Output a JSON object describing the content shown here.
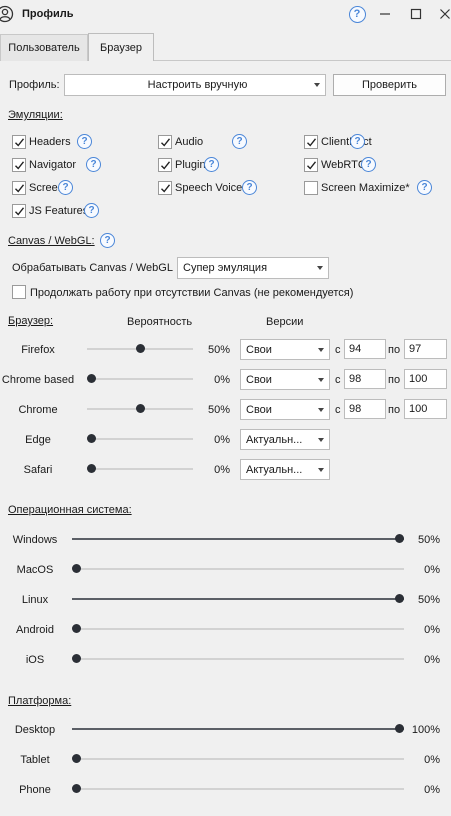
{
  "window": {
    "title": "Профиль"
  },
  "tabs": [
    {
      "label": "Пользователь",
      "active": false
    },
    {
      "label": "Браузер",
      "active": true
    }
  ],
  "profile": {
    "label": "Профиль:",
    "value": "Настроить вручную",
    "check_button": "Проверить"
  },
  "emulations": {
    "title": "Эмуляции:",
    "items": [
      {
        "label": "Headers",
        "checked": true
      },
      {
        "label": "Audio",
        "checked": true
      },
      {
        "label": "ClientRect",
        "checked": true
      },
      {
        "label": "Navigator",
        "checked": true
      },
      {
        "label": "Plugins",
        "checked": true
      },
      {
        "label": "WebRTC",
        "checked": true
      },
      {
        "label": "Screen",
        "checked": true
      },
      {
        "label": "Speech Voice",
        "checked": true
      },
      {
        "label": "Screen Maximize*",
        "checked": false
      },
      {
        "label": "JS Features",
        "checked": true
      }
    ]
  },
  "canvas": {
    "title": "Canvas / WebGL:",
    "process_label": "Обрабатывать Canvas / WebGL",
    "process_value": "Супер эмуляция",
    "continue_label": "Продолжать работу при отсутствии Canvas (не рекомендуется)",
    "continue_checked": false
  },
  "browser": {
    "title": "Браузер:",
    "col_probability": "Вероятность",
    "col_versions": "Версии",
    "from_label": "с",
    "to_label": "по",
    "rows": [
      {
        "name": "Firefox",
        "value": 0.5,
        "pct": "50%",
        "version": "Свои",
        "from": "94",
        "to": "97",
        "has_range": true
      },
      {
        "name": "Chrome based",
        "value": 0.0,
        "pct": "0%",
        "version": "Свои",
        "from": "98",
        "to": "100",
        "has_range": true
      },
      {
        "name": "Chrome",
        "value": 0.5,
        "pct": "50%",
        "version": "Свои",
        "from": "98",
        "to": "100",
        "has_range": true
      },
      {
        "name": "Edge",
        "value": 0.0,
        "pct": "0%",
        "version": "Актуальн...",
        "has_range": false
      },
      {
        "name": "Safari",
        "value": 0.0,
        "pct": "0%",
        "version": "Актуальн...",
        "has_range": false
      }
    ]
  },
  "os": {
    "title": "Операционная система:",
    "rows": [
      {
        "name": "Windows",
        "value": 1.0,
        "pct": "50%"
      },
      {
        "name": "MacOS",
        "value": 0.0,
        "pct": "0%"
      },
      {
        "name": "Linux",
        "value": 1.0,
        "pct": "50%"
      },
      {
        "name": "Android",
        "value": 0.0,
        "pct": "0%"
      },
      {
        "name": "iOS",
        "value": 0.0,
        "pct": "0%"
      }
    ]
  },
  "platform": {
    "title": "Платформа:",
    "rows": [
      {
        "name": "Desktop",
        "value": 1.0,
        "pct": "100%"
      },
      {
        "name": "Tablet",
        "value": 0.0,
        "pct": "0%"
      },
      {
        "name": "Phone",
        "value": 0.0,
        "pct": "0%"
      }
    ]
  },
  "icons": {
    "help": "?"
  },
  "colors": {
    "help_accent": "#4a86d8",
    "slider_thumb": "#2b2f36",
    "window_bg": "#f0f0f0"
  }
}
